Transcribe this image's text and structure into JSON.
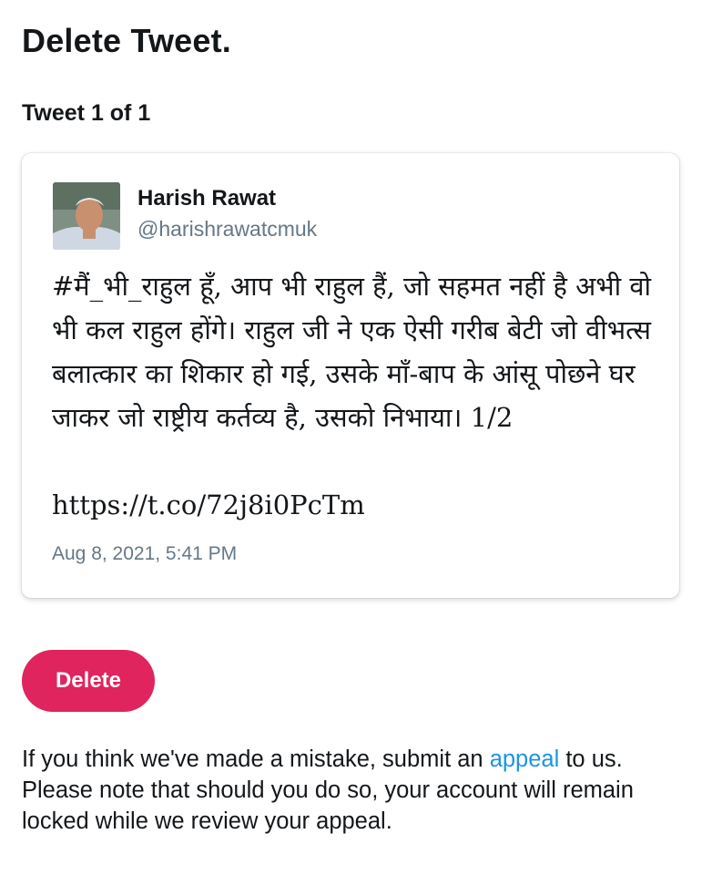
{
  "page": {
    "title": "Delete Tweet.",
    "counter": "Tweet 1 of 1"
  },
  "tweet": {
    "author_name": "Harish Rawat",
    "author_handle": "@harishrawatcmuk",
    "text": "#मैं_भी_राहुल हूँ, आप भी राहुल हैं, जो सहमत नहीं है अभी वो भी कल राहुल होंगे। राहुल जी ने एक ऐसी गरीब बेटी जो वीभत्स बलात्कार का शिकार हो गई, उसके माँ-बाप के आंसू पोछने घर जाकर जो राष्ट्रीय कर्तव्य है, उसको निभाया। 1/2",
    "link": "https://t.co/72j8i0PcTm",
    "date": "Aug 8, 2021, 5:41 PM"
  },
  "actions": {
    "delete_label": "Delete"
  },
  "notice": {
    "before": "If you think we've made a mistake, submit an ",
    "link_text": "appeal",
    "after": " to us. Please note that should you do so, your account will remain locked while we review your appeal."
  },
  "colors": {
    "accent_delete": "#e0245e",
    "link": "#1b95e0",
    "secondary_text": "#657786"
  }
}
